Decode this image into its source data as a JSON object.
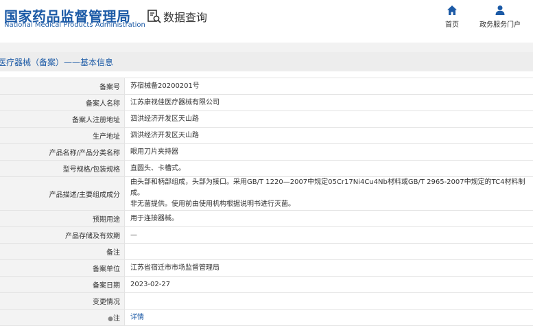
{
  "header": {
    "logo_cn": "国家药品监督管理局",
    "logo_en": "National Medical Products Administration",
    "query_label": "数据查询",
    "nav": [
      {
        "label": "首页",
        "icon": "home-icon"
      },
      {
        "label": "政务服务门户",
        "icon": "user-icon"
      }
    ]
  },
  "section": {
    "title": "医疗器械（备案）——基本信息"
  },
  "rows": [
    {
      "label": "备案号",
      "value": "苏宿械备20200201号"
    },
    {
      "label": "备案人名称",
      "value": "江苏康视佳医疗器械有限公司"
    },
    {
      "label": "备案人注册地址",
      "value": "泗洪经济开发区天山路"
    },
    {
      "label": "生产地址",
      "value": "泗洪经济开发区天山路"
    },
    {
      "label": "产品名称/产品分类名称",
      "value": "眼用刀片夹持器"
    },
    {
      "label": "型号规格/包装规格",
      "value": "直圆头、卡槽式。"
    },
    {
      "label": "产品描述/主要组成成分",
      "value_line1": "由头部和柄部组成，头部为接口。采用GB/T 1220—2007中规定05Cr17Ni4Cu4Nb材料或GB/T 2965-2007中规定的TC4材料制成。",
      "value_line2": "非无菌提供。使用前由使用机构根据说明书进行灭菌。"
    },
    {
      "label": "预期用途",
      "value": "用于连接器械。"
    },
    {
      "label": "产品存储及有效期",
      "value": "—"
    },
    {
      "label": "备注",
      "value": ""
    },
    {
      "label": "备案单位",
      "value": "江苏省宿迁市市场监督管理局"
    },
    {
      "label": "备案日期",
      "value": "2023-02-27"
    },
    {
      "label": "变更情况",
      "value": ""
    },
    {
      "label": "注",
      "value": "详情"
    }
  ],
  "colors": {
    "brand": "#1c5aa6",
    "label_bg": "#f3f3f3",
    "bar_bg": "#ededed"
  }
}
